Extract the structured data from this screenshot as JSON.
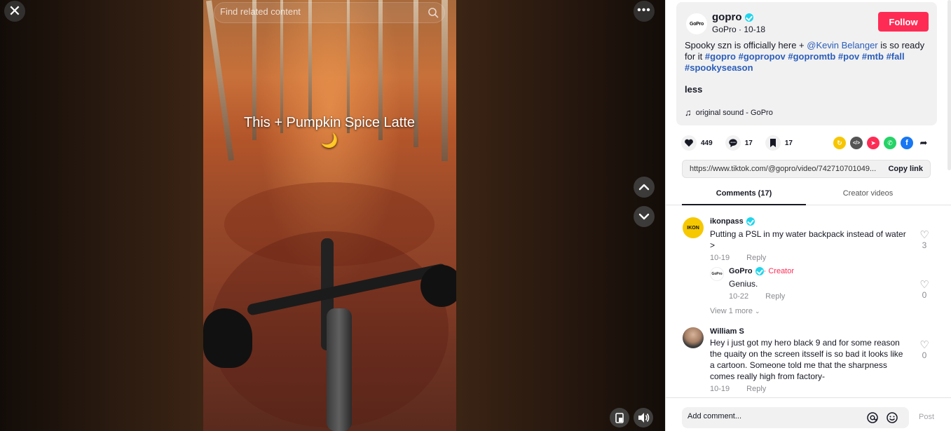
{
  "stage": {
    "close_label": "✕",
    "more_label": "•••",
    "search_placeholder": "Find related content",
    "caption": "This + Pumpkin Spice Latte 🌙"
  },
  "post": {
    "avatar_text": "GoPro",
    "username": "gopro",
    "display_name": "GoPro",
    "date": "10-18",
    "follow_label": "Follow",
    "description_prefix": "Spooky szn is officially here + ",
    "mention": "@Kevin Belanger",
    "description_mid": " is so ready for it ",
    "hashtags": [
      "#gopro",
      "#gopropov",
      "#gopromtb",
      "#pov",
      "#mtb",
      "#fall",
      "#spookyseason"
    ],
    "less_label": "less",
    "sound": "original sound - GoPro"
  },
  "actions": {
    "likes": "449",
    "comments": "17",
    "saves": "17"
  },
  "share_icons": [
    {
      "name": "repost-icon",
      "color": "#f7c600",
      "glyph": "↻"
    },
    {
      "name": "embed-icon",
      "color": "#555555",
      "glyph": "</>"
    },
    {
      "name": "send-icon",
      "color": "#fe2c55",
      "glyph": "➤"
    },
    {
      "name": "whatsapp-icon",
      "color": "#25d366",
      "glyph": "✆"
    },
    {
      "name": "facebook-icon",
      "color": "#1877f2",
      "glyph": "f"
    },
    {
      "name": "share-arrow-icon",
      "color": "#ffffff",
      "glyph": "➦"
    }
  ],
  "link": {
    "url": "https://www.tiktok.com/@gopro/video/742710701049...",
    "copy_label": "Copy link"
  },
  "tabs": {
    "comments": "Comments (17)",
    "creator_videos": "Creator videos"
  },
  "comments": [
    {
      "name": "ikonpass",
      "avatar_text": "IKON",
      "text": "Putting a PSL in my water backpack instead of water >",
      "date": "10-19",
      "reply_label": "Reply",
      "likes": "3"
    },
    {
      "name": "GoPro",
      "creator_label": "· Creator",
      "text": "Genius.",
      "date": "10-22",
      "reply_label": "Reply",
      "likes": "0"
    },
    {
      "name": "William S",
      "text": "Hey i just got my hero black 9 and for some reason the quaity on the screen itsself is so bad it looks like a cartoon. Someone told me that the sharpness comes really high from factory-",
      "date": "10-19",
      "reply_label": "Reply",
      "likes": "0"
    }
  ],
  "view_more": "View 1 more",
  "composer": {
    "placeholder": "Add comment...",
    "post_label": "Post"
  },
  "colors": {
    "accent": "#fe2c55",
    "hashtag": "#2b5db9",
    "verified": "#20d5ec"
  }
}
